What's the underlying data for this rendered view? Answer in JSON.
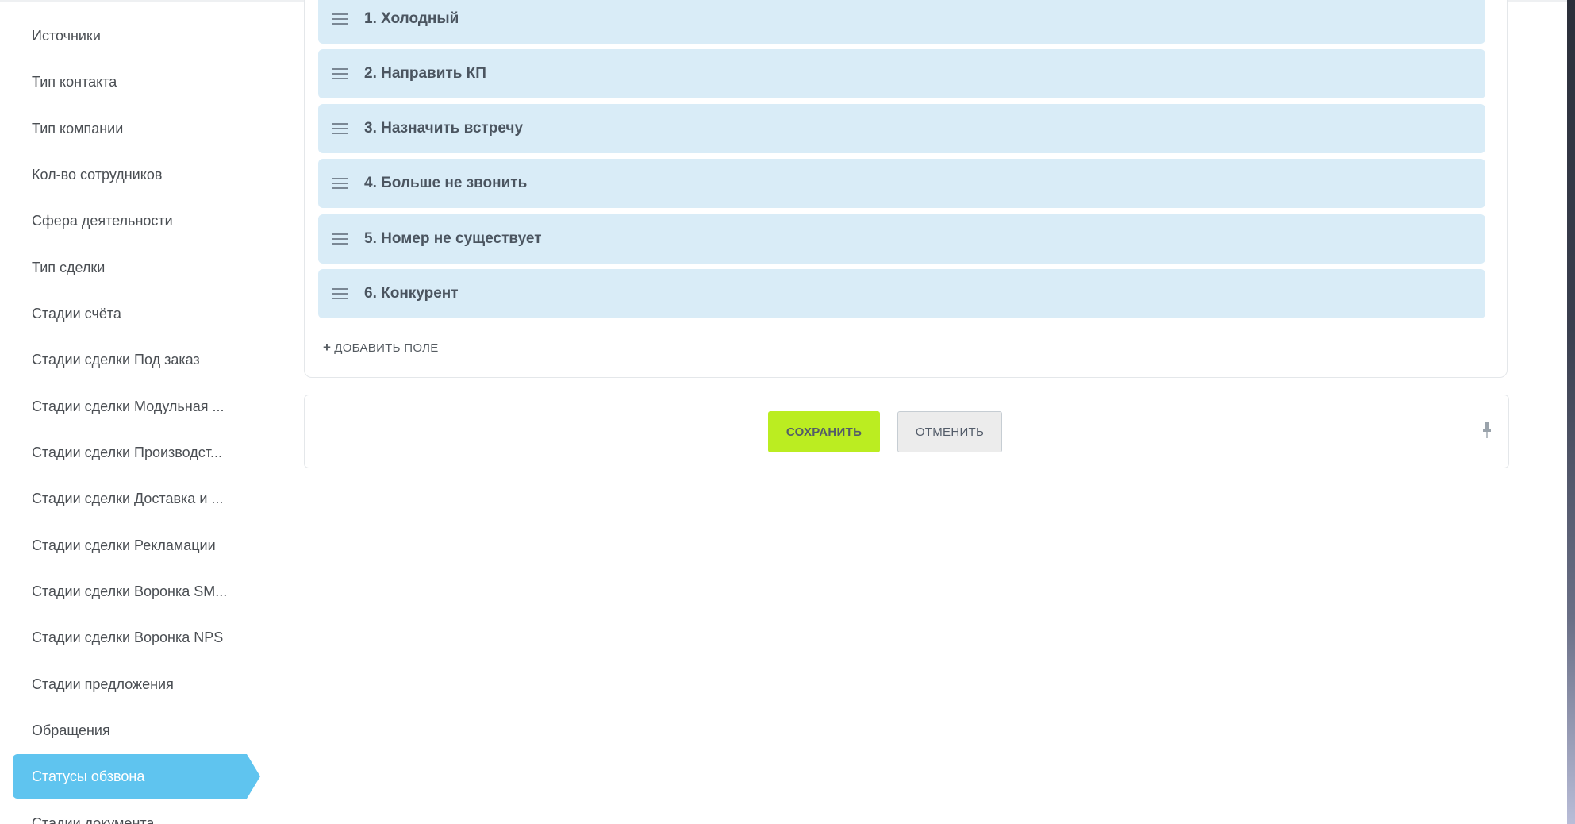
{
  "sidebar": {
    "items": [
      {
        "label": "Источники",
        "active": false
      },
      {
        "label": "Тип контакта",
        "active": false
      },
      {
        "label": "Тип компании",
        "active": false
      },
      {
        "label": "Кол-во сотрудников",
        "active": false
      },
      {
        "label": "Сфера деятельности",
        "active": false
      },
      {
        "label": "Тип сделки",
        "active": false
      },
      {
        "label": "Стадии счёта",
        "active": false
      },
      {
        "label": "Стадии сделки Под заказ",
        "active": false
      },
      {
        "label": "Стадии сделки Модульная ...",
        "active": false
      },
      {
        "label": "Стадии сделки Производст...",
        "active": false
      },
      {
        "label": "Стадии сделки Доставка и ...",
        "active": false
      },
      {
        "label": "Стадии сделки Рекламации",
        "active": false
      },
      {
        "label": "Стадии сделки Воронка SM...",
        "active": false
      },
      {
        "label": "Стадии сделки Воронка NPS",
        "active": false
      },
      {
        "label": "Стадии предложения",
        "active": false
      },
      {
        "label": "Обращения",
        "active": false
      },
      {
        "label": "Статусы обзвона",
        "active": true
      },
      {
        "label": "Стадии документа",
        "active": false
      }
    ],
    "active_color": "#5fc4ef"
  },
  "statuses": {
    "items": [
      {
        "label": "1. Холодный"
      },
      {
        "label": "2. Направить КП"
      },
      {
        "label": "3. Назначить встречу"
      },
      {
        "label": "4. Больше не звонить"
      },
      {
        "label": "5. Номер не существует"
      },
      {
        "label": "6. Конкурент"
      }
    ],
    "row_color": "#d9ecf7",
    "add_field_label": "ДОБАВИТЬ ПОЛЕ",
    "add_field_icon": "plus-icon"
  },
  "toolbar": {
    "save_label": "СОХРАНИТЬ",
    "cancel_label": "ОТМЕНИТЬ",
    "save_color": "#bbed21",
    "pin_icon": "pin-icon"
  }
}
